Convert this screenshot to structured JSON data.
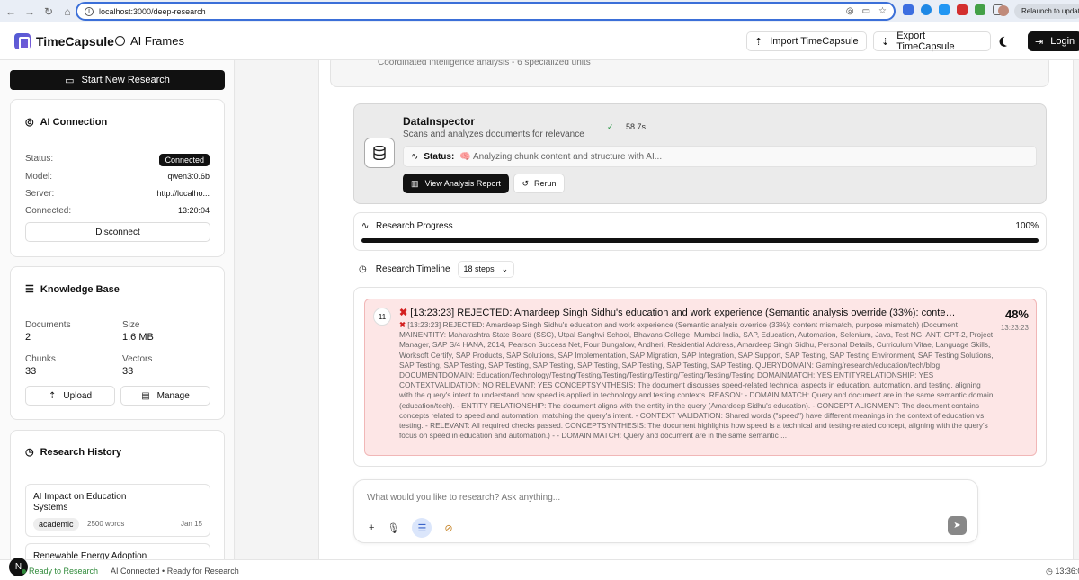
{
  "browser": {
    "url": "localhost:3000/deep-research",
    "relaunch_label": "Relaunch to update"
  },
  "header": {
    "brand": "TimeCapsule",
    "frames_label": "AI Frames",
    "import_label": "Import TimeCapsule",
    "export_label": "Export TimeCapsule",
    "login_label": "Login"
  },
  "sidebar": {
    "start_label": "Start New Research",
    "connection": {
      "title": "AI Connection",
      "status_label": "Status:",
      "status_value": "Connected",
      "model_label": "Model:",
      "model_value": "qwen3:0.6b",
      "server_label": "Server:",
      "server_value": "http://localho...",
      "connected_label": "Connected:",
      "connected_value": "13:20:04",
      "disconnect_label": "Disconnect"
    },
    "knowledge": {
      "title": "Knowledge Base",
      "documents_label": "Documents",
      "documents_value": "2",
      "size_label": "Size",
      "size_value": "1.6 MB",
      "chunks_label": "Chunks",
      "chunks_value": "33",
      "vectors_label": "Vectors",
      "vectors_value": "33",
      "upload_label": "Upload",
      "manage_label": "Manage"
    },
    "history": {
      "title": "Research History",
      "items": [
        {
          "title": "AI Impact on Education Systems",
          "tag": "academic",
          "words": "2500 words",
          "date": "Jan 15"
        },
        {
          "title": "Renewable Energy Adoption",
          "tag": "",
          "words": "",
          "date": ""
        }
      ]
    }
  },
  "main": {
    "top_strip_text": "Coordinated intelligence analysis - 6 specialized units",
    "agent": {
      "name": "DataInspector",
      "description": "Scans and analyzes documents for relevance",
      "duration": "58.7s",
      "status_label": "Status:",
      "status_text": "🧠 Analyzing chunk content and structure with AI...",
      "view_report_label": "View Analysis Report",
      "rerun_label": "Rerun"
    },
    "progress": {
      "label": "Research Progress",
      "value_text": "100%",
      "value": 100
    },
    "timeline": {
      "label": "Research Timeline",
      "steps": "18 steps"
    },
    "entry": {
      "step": "11",
      "title": "[13:23:23] REJECTED: Amardeep Singh Sidhu's education and work experience (Semantic analysis override (33%): content m...",
      "percent": "48%",
      "time": "13:23:23",
      "body": "[13:23:23] REJECTED: Amardeep Singh Sidhu's education and work experience (Semantic analysis override (33%): content mismatch, purpose mismatch) (Document MAINENTITY: Maharashtra State Board (SSC), Utpal Sanghvi School, Bhavans College, Mumbai India, SAP, Education, Automation, Selenium, Java, Test NG, ANT, GPT-2, Project Manager, SAP S/4 HANA, 2014, Pearson Success Net, Four Bungalow, Andheri, Residential Address, Amardeep Singh Sidhu, Personal Details, Curriculum Vitae, Language Skills, Worksoft Certify, SAP Products, SAP Solutions, SAP Implementation, SAP Migration, SAP Integration, SAP Support, SAP Testing, SAP Testing Environment, SAP Testing Solutions, SAP Testing, SAP Testing, SAP Testing, SAP Testing, SAP Testing, SAP Testing, SAP Testing, SAP Testing. QUERYDOMAIN: Gaming/research/education/tech/blog DOCUMENTDOMAIN: Education/Technology/Testing/Testing/Testing/Testing/Testing/Testing/Testing/Testing DOMAINMATCH: YES ENTITYRELATIONSHIP: YES CONTEXTVALIDATION: NO RELEVANT: YES CONCEPTSYNTHESIS: The document discusses speed-related technical aspects in education, automation, and testing, aligning with the query's intent to understand how speed is applied in technology and testing contexts. REASON: - DOMAIN MATCH: Query and document are in the same semantic domain (education/tech). - ENTITY RELATIONSHIP: The document aligns with the entity in the query (Amardeep Sidhu's education). - CONCEPT ALIGNMENT: The document contains concepts related to speed and automation, matching the query's intent. - CONTEXT VALIDATION: Shared words (\"speed\") have different meanings in the context of education vs. testing. - RELEVANT: All required checks passed. CONCEPTSYNTHESIS: The document highlights how speed is a technical and testing-related concept, aligning with the query's focus on speed in education and automation.) - - DOMAIN MATCH: Query and document are in the same semantic ..."
    },
    "composer": {
      "placeholder": "What would you like to research? Ask anything..."
    }
  },
  "footer": {
    "badge": "N",
    "ready": "Ready to Research",
    "status": "AI Connected • Ready for Research",
    "time": "13:36:0"
  },
  "colors": {
    "accent_dark": "#111111",
    "rejected_bg": "#fde6e6",
    "ready_green": "#2f8a3a"
  }
}
